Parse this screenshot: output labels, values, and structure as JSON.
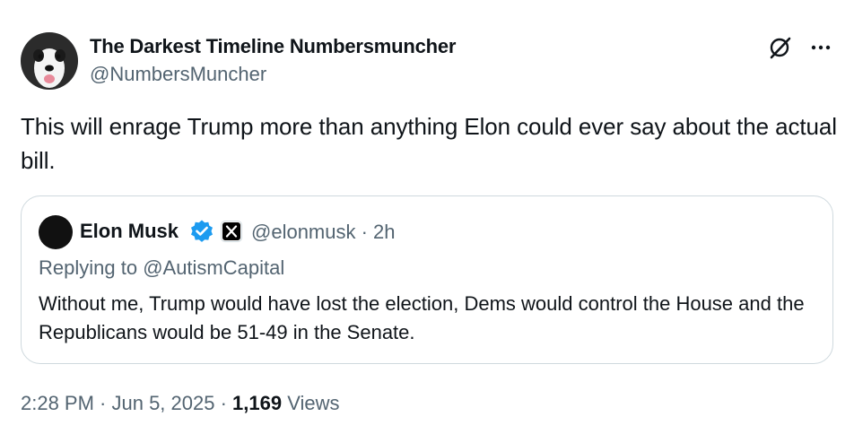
{
  "author": {
    "name": "The Darkest Timeline Numbersmuncher",
    "handle": "@NumbersMuncher",
    "avatar": "dog-photo"
  },
  "tweet": {
    "text": "This will enrage Trump more than anything Elon could ever say about the actual bill."
  },
  "header_actions": {
    "grok_icon": "grok-icon",
    "more_icon": "more-icon"
  },
  "quote": {
    "name": "Elon Musk",
    "handle_time": "@elonmusk · 2h",
    "replying_prefix": "Replying to ",
    "replying_to": "@AutismCapital",
    "text": "Without me, Trump would have lost the election, Dems would control the House and the Republicans would be 51-49 in the Senate.",
    "verified_color": "#1d9bf0"
  },
  "meta": {
    "time_date": "2:28 PM · Jun 5, 2025 · ",
    "views_count": "1,169",
    "views_label": " Views"
  }
}
